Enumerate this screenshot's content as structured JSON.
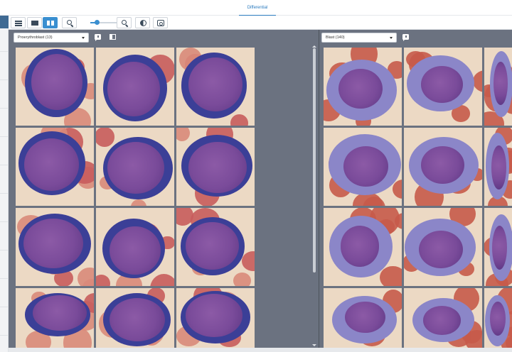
{
  "tabs": [
    {
      "label": "Differential",
      "active": true
    }
  ],
  "toolbar": {
    "buttons": [
      {
        "icon": "menu-icon",
        "state": "default"
      },
      {
        "icon": "single-view-icon",
        "state": "default"
      },
      {
        "icon": "split-view-icon",
        "state": "active"
      },
      {
        "icon": "zoom-out-icon",
        "state": "default"
      },
      {
        "icon": "zoom-in-icon",
        "state": "default"
      },
      {
        "icon": "contrast-icon",
        "state": "default"
      },
      {
        "icon": "view-toggle-icon",
        "state": "default"
      }
    ],
    "zoom_level": 0.22
  },
  "left_panel": {
    "select_value": "Proerythroblast (13)",
    "icons": [
      "comment-icon",
      "layout-icon"
    ]
  },
  "right_panel": {
    "select_value": "Blast (140)",
    "icons": [
      "comment-icon"
    ]
  },
  "colors": {
    "accent": "#3a8fd0",
    "panel_bg": "#6b7280",
    "stain_cytoplasm": "#8b86c8",
    "stain_nucleus": "#7a4b9a",
    "rbc": "#c75a4a",
    "background_smear": "#ecd9c4"
  }
}
